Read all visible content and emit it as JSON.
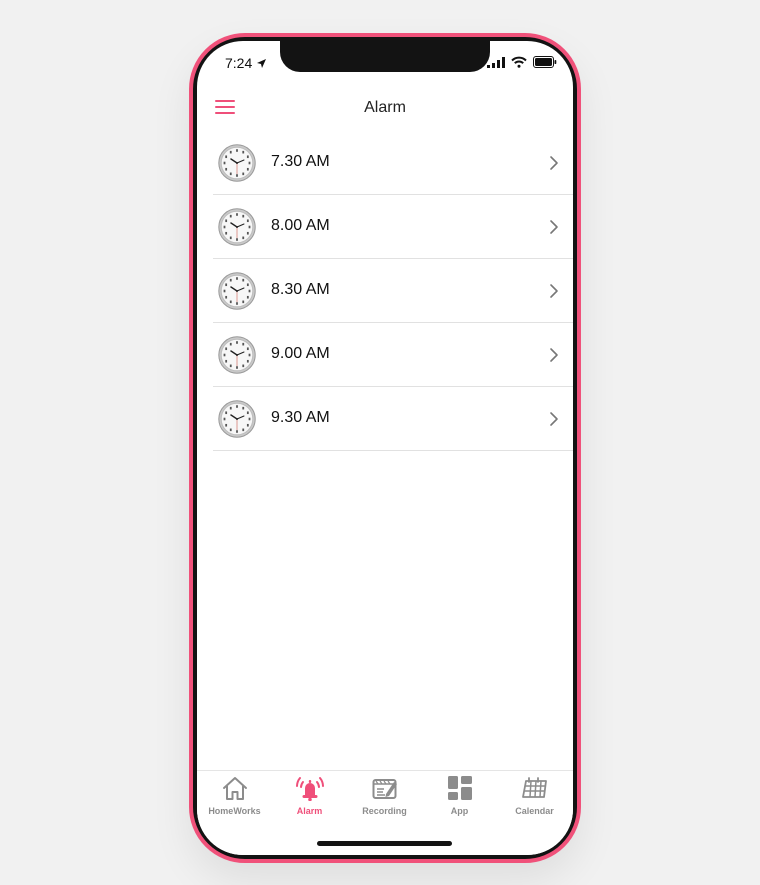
{
  "status": {
    "time": "7:24"
  },
  "header": {
    "title": "Alarm"
  },
  "alarms": [
    {
      "label": "7.30 AM"
    },
    {
      "label": "8.00 AM"
    },
    {
      "label": "8.30 AM"
    },
    {
      "label": "9.00 AM"
    },
    {
      "label": "9.30 AM"
    }
  ],
  "tabs": [
    {
      "label": "HomeWorks",
      "icon": "home-icon",
      "active": false
    },
    {
      "label": "Alarm",
      "icon": "alarm-bell-icon",
      "active": true
    },
    {
      "label": "Recording",
      "icon": "recording-icon",
      "active": false
    },
    {
      "label": "App",
      "icon": "app-grid-icon",
      "active": false
    },
    {
      "label": "Calendar",
      "icon": "calendar-icon",
      "active": false
    }
  ],
  "colors": {
    "accent": "#ef4f7a",
    "frame": "#f0517a",
    "inactive": "#8c8c8c"
  }
}
